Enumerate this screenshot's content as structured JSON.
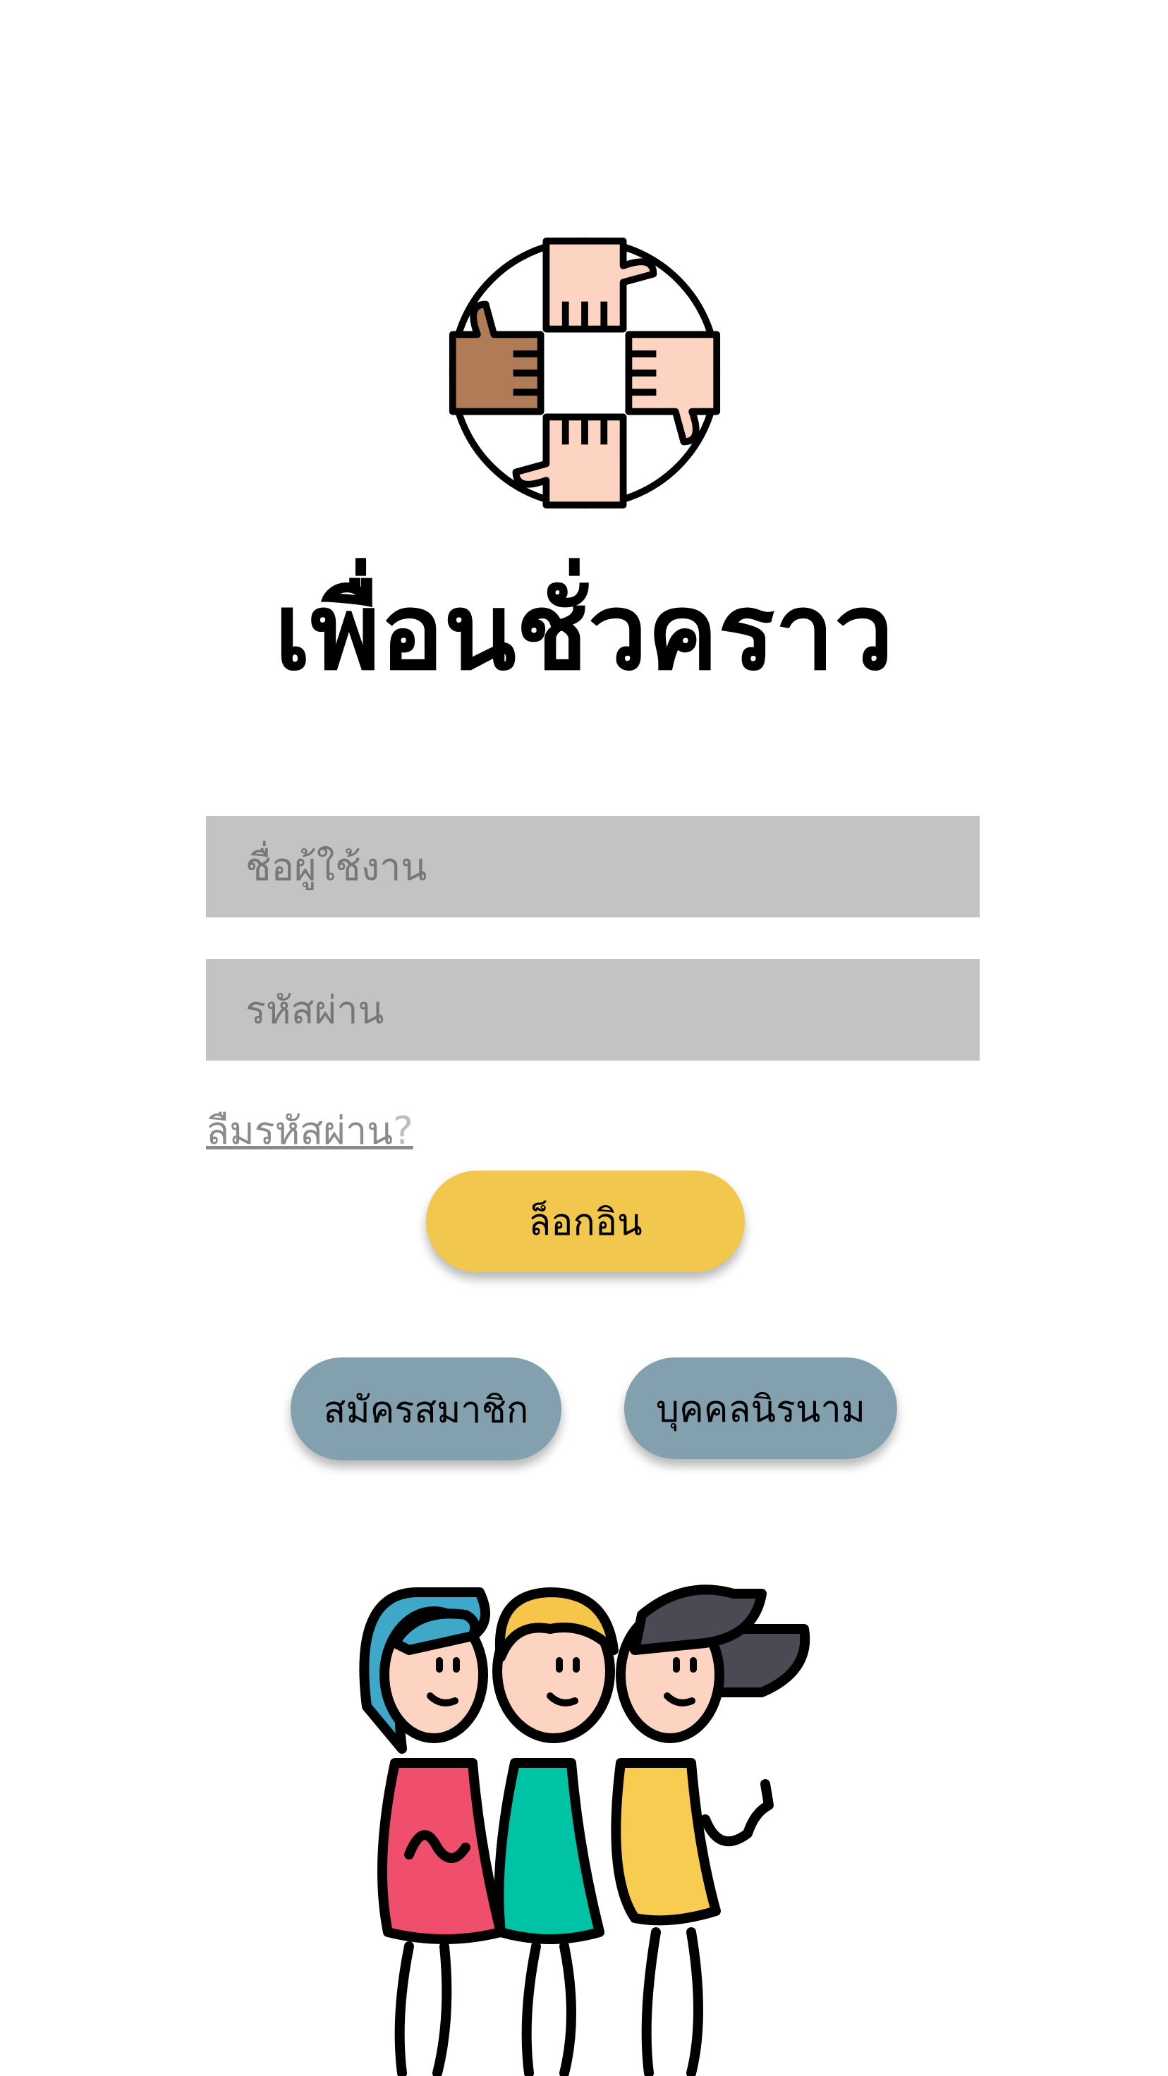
{
  "app": {
    "title": "เพื่อนชั่วคราว"
  },
  "login_form": {
    "username_placeholder": "ชื่อผู้ใช้งาน",
    "password_placeholder": "รหัสผ่าน",
    "forgot_password_label": "ลืมรหัสผ่าน",
    "forgot_password_mark": "?",
    "login_button": "ล็อกอิน"
  },
  "secondary_actions": {
    "signup_button": "สมัครสมาชิก",
    "guest_button": "บุคคลนิรนาม"
  },
  "colors": {
    "login_button": "#f1c84d",
    "secondary_button": "#83a0ae",
    "input_background": "#c3c3c3"
  },
  "icons": {
    "logo": "four-hands-circle-icon",
    "illustration": "three-friends-illustration"
  }
}
